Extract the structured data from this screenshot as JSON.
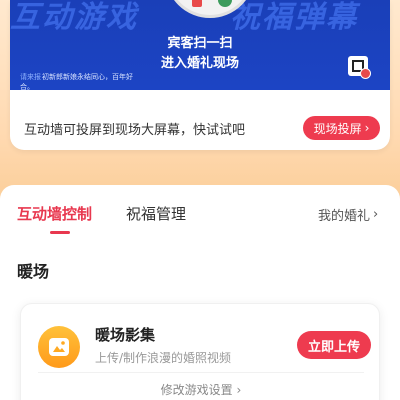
{
  "banner": {
    "watermark_left": "互动游戏",
    "watermark_right": "祝福弹幕",
    "title_line1": "宾客扫一扫",
    "title_line2": "进入婚礼现场",
    "chat_name": "请来报",
    "chat_message": "初新郎新娘永结同心，百年好",
    "chat_message_cont": "合。"
  },
  "tip": {
    "text": "互动墙可投屏到现场大屏幕，快试试吧",
    "cast_button": "现场投屏"
  },
  "tabs": [
    {
      "label": "互动墙控制",
      "active": true
    },
    {
      "label": "祝福管理",
      "active": false
    }
  ],
  "my_wedding": "我的婚礼",
  "section": {
    "title": "暖场"
  },
  "card": {
    "title": "暖场影集",
    "subtitle": "上传/制作浪漫的婚照视频",
    "upload_button": "立即上传",
    "settings_link": "修改游戏设置"
  },
  "colors": {
    "accent": "#ee3b4f",
    "banner_blue": "#1c44c4",
    "icon_orange": "#ffa921"
  }
}
